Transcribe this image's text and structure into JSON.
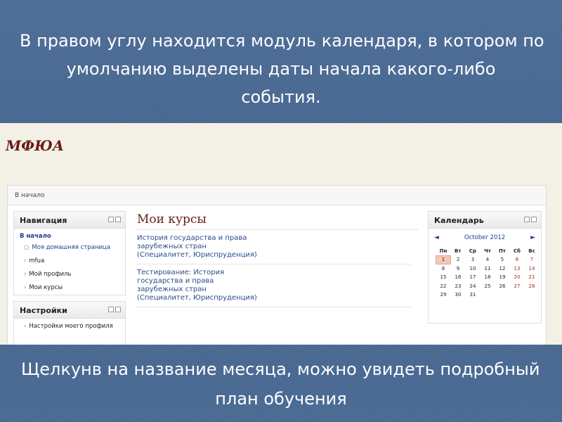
{
  "slide": {
    "caption_top_line1": "В правом углу находится модуль календаря, в котором по",
    "caption_top_line2": "умолчанию выделены даты начала какого-либо",
    "caption_top_line3": "события.",
    "caption_bottom_line1": "Щелкунв на название месяца, можно увидеть подробный",
    "caption_bottom_line2": "план обучения"
  },
  "site": {
    "title": "МФЮА",
    "breadcrumb": "В начало"
  },
  "navigation": {
    "title": "Навигация",
    "root": "В начало",
    "items": [
      {
        "label": "Моя домашняя страница",
        "bullet": "○",
        "link": true
      },
      {
        "label": "mfua",
        "bullet": "›",
        "link": false
      },
      {
        "label": "Мой профиль",
        "bullet": "›",
        "link": false
      },
      {
        "label": "Мои курсы",
        "bullet": "›",
        "link": false
      }
    ]
  },
  "settings": {
    "title": "Настройки",
    "items": [
      {
        "label": "Настройки моего профиля",
        "bullet": "›"
      }
    ]
  },
  "main": {
    "title": "Мои курсы",
    "courses": [
      {
        "line1": "История государства и права",
        "line2": "зарубежных стран",
        "line3": "(Специалитет, Юриспруденция)",
        "line4": ""
      },
      {
        "line1": "Тестирование: История",
        "line2": "государства и права",
        "line3": "зарубежных стран",
        "line4": "(Специалитет, Юриспруденция)"
      }
    ]
  },
  "calendar": {
    "title": "Календарь",
    "month": "October 2012",
    "prev": "◄",
    "next": "►",
    "weekdays": [
      "Пн",
      "Вт",
      "Ср",
      "Чт",
      "Пт",
      "Сб",
      "Вс"
    ],
    "weeks": [
      [
        "1",
        "2",
        "3",
        "4",
        "5",
        "6",
        "7"
      ],
      [
        "8",
        "9",
        "10",
        "11",
        "12",
        "13",
        "14"
      ],
      [
        "15",
        "16",
        "17",
        "18",
        "19",
        "20",
        "21"
      ],
      [
        "22",
        "23",
        "24",
        "25",
        "26",
        "27",
        "28"
      ],
      [
        "29",
        "30",
        "31",
        "",
        "",
        "",
        ""
      ]
    ],
    "today": "1",
    "colors": {
      "weekend": "#b02222",
      "today_bg": "#f6c7b6"
    }
  }
}
